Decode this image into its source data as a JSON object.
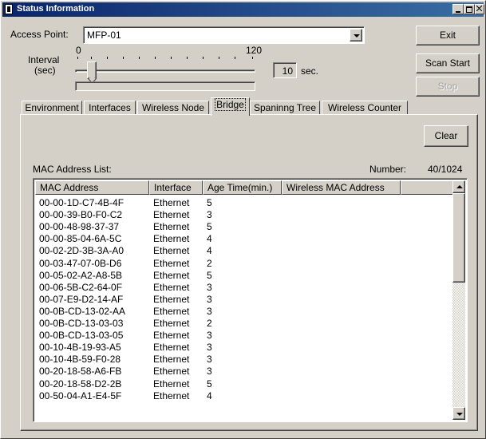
{
  "window": {
    "title": "Status Information"
  },
  "access_point": {
    "label": "Access Point:",
    "value": "MFP-01"
  },
  "interval": {
    "label_line1": "Interval",
    "label_line2": "(sec)",
    "min_label": "0",
    "max_label": "120",
    "value": "10",
    "unit": "sec.",
    "slider_fraction": 0.083
  },
  "buttons": {
    "exit": "Exit",
    "scan_start": "Scan Start",
    "stop": "Stop",
    "clear": "Clear"
  },
  "tabs": [
    {
      "label": "Environment"
    },
    {
      "label": "Interfaces"
    },
    {
      "label": "Wireless Node"
    },
    {
      "label": "Bridge",
      "active": true
    },
    {
      "label": "Spaninng Tree"
    },
    {
      "label": "Wireless Counter"
    }
  ],
  "mac_list": {
    "title": "MAC Address List:",
    "number_label": "Number:",
    "number_value": "40/1024",
    "columns": [
      "MAC Address",
      "Interface",
      "Age Time(min.)",
      "Wireless MAC Address"
    ],
    "rows": [
      [
        "00-00-1D-C7-4B-4F",
        "Ethernet",
        "5",
        ""
      ],
      [
        "00-00-39-B0-F0-C2",
        "Ethernet",
        "3",
        ""
      ],
      [
        "00-00-48-98-37-37",
        "Ethernet",
        "5",
        ""
      ],
      [
        "00-00-85-04-6A-5C",
        "Ethernet",
        "4",
        ""
      ],
      [
        "00-02-2D-3B-3A-A0",
        "Ethernet",
        "4",
        ""
      ],
      [
        "00-03-47-07-0B-D6",
        "Ethernet",
        "2",
        ""
      ],
      [
        "00-05-02-A2-A8-5B",
        "Ethernet",
        "5",
        ""
      ],
      [
        "00-06-5B-C2-64-0F",
        "Ethernet",
        "3",
        ""
      ],
      [
        "00-07-E9-D2-14-AF",
        "Ethernet",
        "3",
        ""
      ],
      [
        "00-0B-CD-13-02-AA",
        "Ethernet",
        "3",
        ""
      ],
      [
        "00-0B-CD-13-03-03",
        "Ethernet",
        "2",
        ""
      ],
      [
        "00-0B-CD-13-03-05",
        "Ethernet",
        "3",
        ""
      ],
      [
        "00-10-4B-19-93-A5",
        "Ethernet",
        "3",
        ""
      ],
      [
        "00-10-4B-59-F0-28",
        "Ethernet",
        "3",
        ""
      ],
      [
        "00-20-18-58-A6-FB",
        "Ethernet",
        "3",
        ""
      ],
      [
        "00-20-18-58-D2-2B",
        "Ethernet",
        "5",
        ""
      ],
      [
        "00-50-04-A1-E4-5F",
        "Ethernet",
        "4",
        ""
      ]
    ]
  },
  "icons": {
    "app": "app-icon",
    "minimize": "minimize-icon",
    "maximize": "maximize-icon",
    "close": "close-icon",
    "dropdown": "chevron-down-icon",
    "scroll_up": "arrow-up-icon",
    "scroll_down": "arrow-down-icon"
  },
  "colors": {
    "titlebar_start": "#0a246a",
    "titlebar_end": "#3a6ea5",
    "face": "#d4d0c8",
    "disabled_text": "#808080"
  }
}
